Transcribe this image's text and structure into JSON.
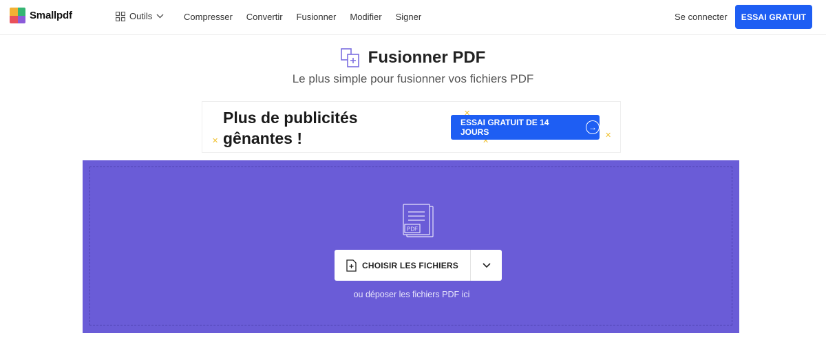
{
  "header": {
    "logo_text": "Smallpdf",
    "tools_label": "Outils",
    "nav": [
      "Compresser",
      "Convertir",
      "Fusionner",
      "Modifier",
      "Signer"
    ],
    "login_label": "Se connecter",
    "cta_label": "ESSAI GRATUIT"
  },
  "hero": {
    "title": "Fusionner PDF",
    "subtitle": "Le plus simple pour fusionner vos fichiers PDF"
  },
  "ad": {
    "text": "Plus de publicités gênantes !",
    "button_label": "ESSAI GRATUIT DE 14 JOURS"
  },
  "dropzone": {
    "icon_label": "PDF",
    "choose_label": "CHOISIR LES FICHIERS",
    "hint": "ou déposer les fichiers PDF ici"
  },
  "colors": {
    "accent": "#1e5ef3",
    "dropzone": "#6a5cd7",
    "tool_icon": "#7b6ee0"
  }
}
